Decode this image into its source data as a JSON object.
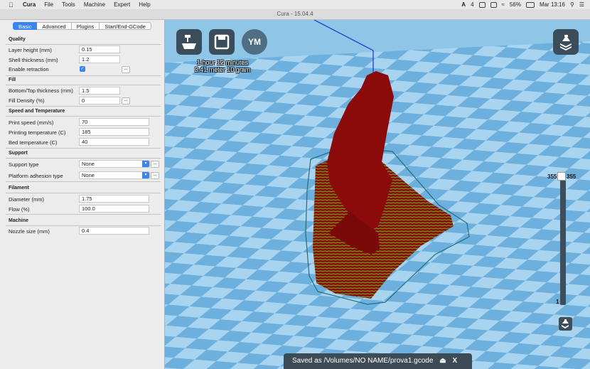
{
  "menubar": {
    "app": "Cura",
    "items": [
      "File",
      "Tools",
      "Machine",
      "Expert",
      "Help"
    ],
    "status": {
      "battery": "56%",
      "clock": "Mar 13:16",
      "count": "4"
    }
  },
  "window": {
    "title": "Cura - 15.04.4"
  },
  "tabs": [
    "Basic",
    "Advanced",
    "Plugins",
    "Start/End-GCode"
  ],
  "sections": {
    "quality": "Quality",
    "fill": "Fill",
    "speed": "Speed and Temperature",
    "support": "Support",
    "filament": "Filament",
    "machine": "Machine"
  },
  "settings": {
    "layer_height": {
      "label": "Layer height (mm)",
      "value": "0.15"
    },
    "shell_thickness": {
      "label": "Shell thickness (mm)",
      "value": "1.2"
    },
    "enable_retraction": {
      "label": "Enable retraction",
      "checked": true
    },
    "bottom_top_thickness": {
      "label": "Bottom/Top thickness (mm)",
      "value": "1.5"
    },
    "fill_density": {
      "label": "Fill Density (%)",
      "value": "0"
    },
    "print_speed": {
      "label": "Print speed (mm/s)",
      "value": "70"
    },
    "printing_temperature": {
      "label": "Printing temperature (C)",
      "value": "185"
    },
    "bed_temperature": {
      "label": "Bed temperature (C)",
      "value": "40"
    },
    "support_type": {
      "label": "Support type",
      "value": "None"
    },
    "platform_adhesion": {
      "label": "Platform adhesion type",
      "value": "None"
    },
    "diameter": {
      "label": "Diameter (mm)",
      "value": "1.75"
    },
    "flow": {
      "label": "Flow (%)",
      "value": "100.0"
    },
    "nozzle_size": {
      "label": "Nozzle size (mm)",
      "value": "0.4"
    }
  },
  "dots_label": "...",
  "viewport": {
    "ym_label": "YM",
    "print_time": "1 hour 12 minutes",
    "print_material": "3.41 meter 10 gram",
    "layer_slider": {
      "max": "355",
      "max_right": "355",
      "min": "1"
    },
    "status": "Saved as /Volumes/NO NAME/prova1.gcode",
    "eject": "⏏",
    "close": "X"
  },
  "colors": {
    "accent": "#3a84f0",
    "model": "#8b0a0a",
    "infill": "#5f8b1e",
    "bed_light": "#a8d4ef",
    "bed_dark": "#6fb0dc"
  },
  "icons": [
    "apple-icon",
    "load-model-icon",
    "save-icon",
    "view-mode-icon",
    "layer-view-icon",
    "eject-icon",
    "checkbox-check-icon",
    "dropdown-arrow-icon"
  ]
}
